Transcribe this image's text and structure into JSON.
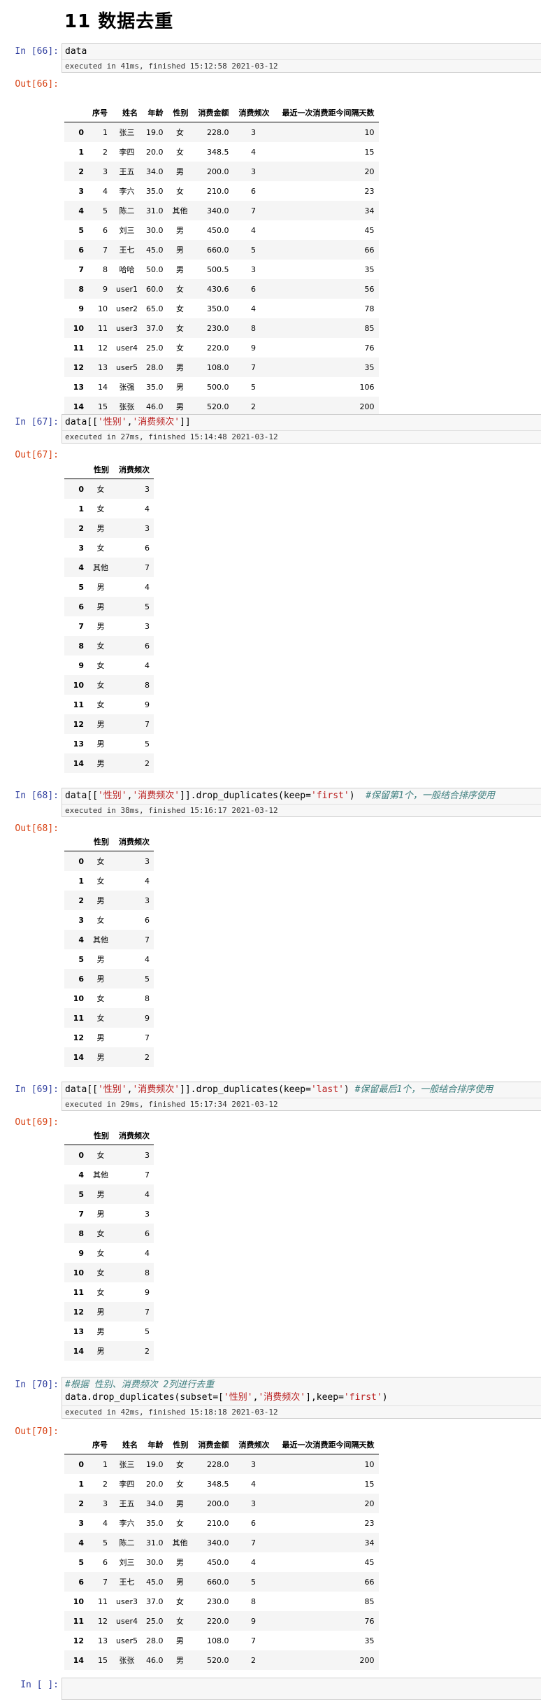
{
  "heading": "11   数据去重",
  "cells": [
    {
      "in": "In [66]:",
      "code_parts": [
        [
          "data",
          ""
        ]
      ],
      "exec": "executed in 41ms, finished 15:12:58 2021-03-12",
      "out": "Out[66]:",
      "columns": [
        "",
        "序号",
        "姓名",
        "年龄",
        "性别",
        "消费金额",
        "消费频次",
        "最近一次消费距今间隔天数"
      ],
      "rows": [
        [
          "0",
          "1",
          "张三",
          "19.0",
          "女",
          "228.0",
          "3",
          "10"
        ],
        [
          "1",
          "2",
          "李四",
          "20.0",
          "女",
          "348.5",
          "4",
          "15"
        ],
        [
          "2",
          "3",
          "王五",
          "34.0",
          "男",
          "200.0",
          "3",
          "20"
        ],
        [
          "3",
          "4",
          "李六",
          "35.0",
          "女",
          "210.0",
          "6",
          "23"
        ],
        [
          "4",
          "5",
          "陈二",
          "31.0",
          "其他",
          "340.0",
          "7",
          "34"
        ],
        [
          "5",
          "6",
          "刘三",
          "30.0",
          "男",
          "450.0",
          "4",
          "45"
        ],
        [
          "6",
          "7",
          "王七",
          "45.0",
          "男",
          "660.0",
          "5",
          "66"
        ],
        [
          "7",
          "8",
          "哈哈",
          "50.0",
          "男",
          "500.5",
          "3",
          "35"
        ],
        [
          "8",
          "9",
          "user1",
          "60.0",
          "女",
          "430.6",
          "6",
          "56"
        ],
        [
          "9",
          "10",
          "user2",
          "65.0",
          "女",
          "350.0",
          "4",
          "78"
        ],
        [
          "10",
          "11",
          "user3",
          "37.0",
          "女",
          "230.0",
          "8",
          "85"
        ],
        [
          "11",
          "12",
          "user4",
          "25.0",
          "女",
          "220.0",
          "9",
          "76"
        ],
        [
          "12",
          "13",
          "user5",
          "28.0",
          "男",
          "108.0",
          "7",
          "35"
        ],
        [
          "13",
          "14",
          "张强",
          "35.0",
          "男",
          "500.0",
          "5",
          "106"
        ],
        [
          "14",
          "15",
          "张张",
          "46.0",
          "男",
          "520.0",
          "2",
          "200"
        ]
      ]
    },
    {
      "in": "In [67]:",
      "code_parts": [
        [
          "data[[",
          ""
        ],
        [
          "'性别'",
          "str"
        ],
        [
          ",",
          ""
        ],
        [
          "'消费频次'",
          "str"
        ],
        [
          "]]",
          ""
        ]
      ],
      "exec": "executed in 27ms, finished 15:14:48 2021-03-12",
      "out": "Out[67]:",
      "columns": [
        "",
        "性别",
        "消费频次"
      ],
      "rows": [
        [
          "0",
          "女",
          "3"
        ],
        [
          "1",
          "女",
          "4"
        ],
        [
          "2",
          "男",
          "3"
        ],
        [
          "3",
          "女",
          "6"
        ],
        [
          "4",
          "其他",
          "7"
        ],
        [
          "5",
          "男",
          "4"
        ],
        [
          "6",
          "男",
          "5"
        ],
        [
          "7",
          "男",
          "3"
        ],
        [
          "8",
          "女",
          "6"
        ],
        [
          "9",
          "女",
          "4"
        ],
        [
          "10",
          "女",
          "8"
        ],
        [
          "11",
          "女",
          "9"
        ],
        [
          "12",
          "男",
          "7"
        ],
        [
          "13",
          "男",
          "5"
        ],
        [
          "14",
          "男",
          "2"
        ]
      ]
    },
    {
      "in": "In [68]:",
      "code_parts": [
        [
          "data[[",
          ""
        ],
        [
          "'性别'",
          "str"
        ],
        [
          ",",
          ""
        ],
        [
          "'消费频次'",
          "str"
        ],
        [
          "]].drop_duplicates(keep=",
          ""
        ],
        [
          "'first'",
          "str"
        ],
        [
          ")  ",
          ""
        ],
        [
          "#保留第1个，一般结合排序使用",
          "cmt"
        ]
      ],
      "exec": "executed in 38ms, finished 15:16:17 2021-03-12",
      "out": "Out[68]:",
      "columns": [
        "",
        "性别",
        "消费频次"
      ],
      "rows": [
        [
          "0",
          "女",
          "3"
        ],
        [
          "1",
          "女",
          "4"
        ],
        [
          "2",
          "男",
          "3"
        ],
        [
          "3",
          "女",
          "6"
        ],
        [
          "4",
          "其他",
          "7"
        ],
        [
          "5",
          "男",
          "4"
        ],
        [
          "6",
          "男",
          "5"
        ],
        [
          "10",
          "女",
          "8"
        ],
        [
          "11",
          "女",
          "9"
        ],
        [
          "12",
          "男",
          "7"
        ],
        [
          "14",
          "男",
          "2"
        ]
      ]
    },
    {
      "in": "In [69]:",
      "code_parts": [
        [
          "data[[",
          ""
        ],
        [
          "'性别'",
          "str"
        ],
        [
          ",",
          ""
        ],
        [
          "'消费频次'",
          "str"
        ],
        [
          "]].drop_duplicates(keep=",
          ""
        ],
        [
          "'last'",
          "str"
        ],
        [
          ") ",
          ""
        ],
        [
          "#保留最后1个，一般结合排序使用",
          "cmt"
        ]
      ],
      "exec": "executed in 29ms, finished 15:17:34 2021-03-12",
      "out": "Out[69]:",
      "columns": [
        "",
        "性别",
        "消费频次"
      ],
      "rows": [
        [
          "0",
          "女",
          "3"
        ],
        [
          "4",
          "其他",
          "7"
        ],
        [
          "5",
          "男",
          "4"
        ],
        [
          "7",
          "男",
          "3"
        ],
        [
          "8",
          "女",
          "6"
        ],
        [
          "9",
          "女",
          "4"
        ],
        [
          "10",
          "女",
          "8"
        ],
        [
          "11",
          "女",
          "9"
        ],
        [
          "12",
          "男",
          "7"
        ],
        [
          "13",
          "男",
          "5"
        ],
        [
          "14",
          "男",
          "2"
        ]
      ]
    },
    {
      "in": "In [70]:",
      "code_parts": [
        [
          "#根据 性别、消费频次 2列进行去重",
          "cmt"
        ],
        [
          "\ndata.drop_duplicates(subset=[",
          ""
        ],
        [
          "'性别'",
          "str"
        ],
        [
          ",",
          ""
        ],
        [
          "'消费频次'",
          "str"
        ],
        [
          "],keep=",
          ""
        ],
        [
          "'first'",
          "str"
        ],
        [
          ")",
          ""
        ]
      ],
      "exec": "executed in 42ms, finished 15:18:18 2021-03-12",
      "out": "Out[70]:",
      "columns": [
        "",
        "序号",
        "姓名",
        "年龄",
        "性别",
        "消费金额",
        "消费频次",
        "最近一次消费距今间隔天数"
      ],
      "rows": [
        [
          "0",
          "1",
          "张三",
          "19.0",
          "女",
          "228.0",
          "3",
          "10"
        ],
        [
          "1",
          "2",
          "李四",
          "20.0",
          "女",
          "348.5",
          "4",
          "15"
        ],
        [
          "2",
          "3",
          "王五",
          "34.0",
          "男",
          "200.0",
          "3",
          "20"
        ],
        [
          "3",
          "4",
          "李六",
          "35.0",
          "女",
          "210.0",
          "6",
          "23"
        ],
        [
          "4",
          "5",
          "陈二",
          "31.0",
          "其他",
          "340.0",
          "7",
          "34"
        ],
        [
          "5",
          "6",
          "刘三",
          "30.0",
          "男",
          "450.0",
          "4",
          "45"
        ],
        [
          "6",
          "7",
          "王七",
          "45.0",
          "男",
          "660.0",
          "5",
          "66"
        ],
        [
          "10",
          "11",
          "user3",
          "37.0",
          "女",
          "230.0",
          "8",
          "85"
        ],
        [
          "11",
          "12",
          "user4",
          "25.0",
          "女",
          "220.0",
          "9",
          "76"
        ],
        [
          "12",
          "13",
          "user5",
          "28.0",
          "男",
          "108.0",
          "7",
          "35"
        ],
        [
          "14",
          "15",
          "张张",
          "46.0",
          "男",
          "520.0",
          "2",
          "200"
        ]
      ]
    }
  ],
  "last_in": "In [ ]:"
}
